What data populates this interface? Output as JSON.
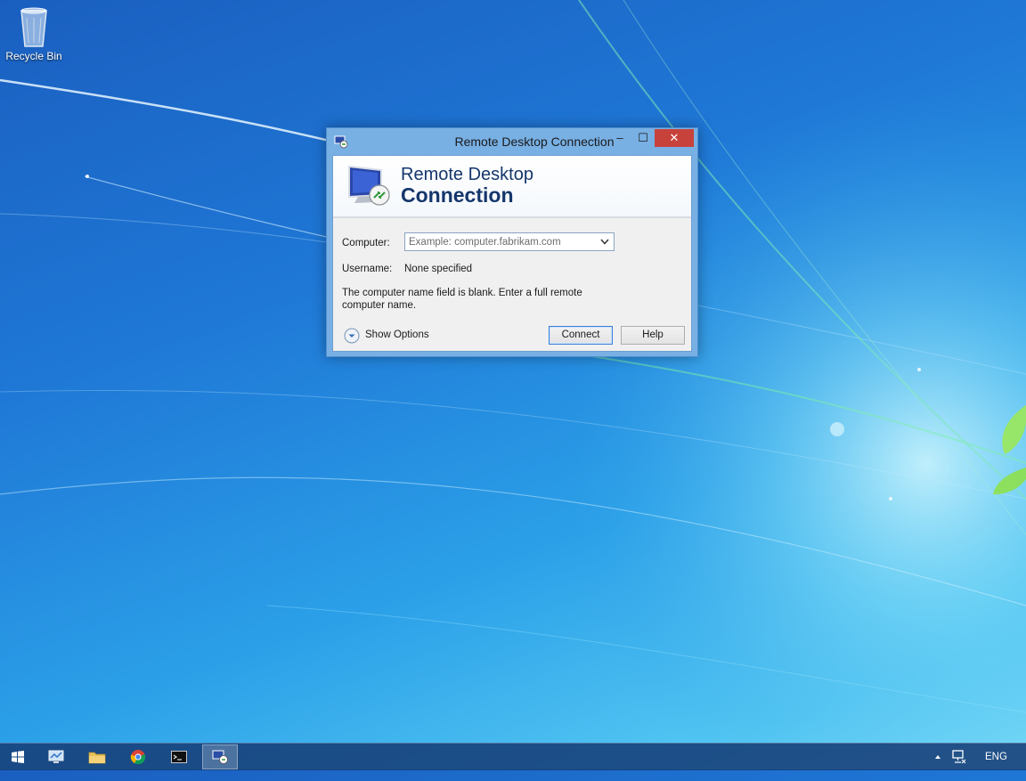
{
  "desktop": {
    "recycle_bin_label": "Recycle Bin"
  },
  "window": {
    "title": "Remote Desktop Connection",
    "controls": {
      "minimize": "‒",
      "maximize": "☐",
      "close": "✕"
    },
    "banner": {
      "line1": "Remote Desktop",
      "line2": "Connection"
    },
    "computer_label": "Computer:",
    "computer_value": "",
    "computer_placeholder": "Example: computer.fabrikam.com",
    "username_label": "Username:",
    "username_value": "None specified",
    "message": "The computer name field is blank. Enter a full remote computer name.",
    "show_options_label": "Show Options",
    "connect_label": "Connect",
    "help_label": "Help"
  },
  "taskbar": {
    "items": [
      {
        "name": "start",
        "icon": "windows-logo-icon"
      },
      {
        "name": "server-manager",
        "icon": "server-manager-icon"
      },
      {
        "name": "file-explorer",
        "icon": "folder-icon"
      },
      {
        "name": "chrome",
        "icon": "chrome-icon"
      },
      {
        "name": "command-prompt",
        "icon": "command-prompt-icon"
      },
      {
        "name": "remote-desktop",
        "icon": "remote-desktop-icon",
        "active": true
      }
    ],
    "language": "ENG"
  },
  "colors": {
    "title_text": "#1a1a1a",
    "banner_text": "#15366b",
    "close_button": "#c7423a",
    "window_frame": "#78b0e4",
    "default_button_border": "#3c7fd6"
  }
}
